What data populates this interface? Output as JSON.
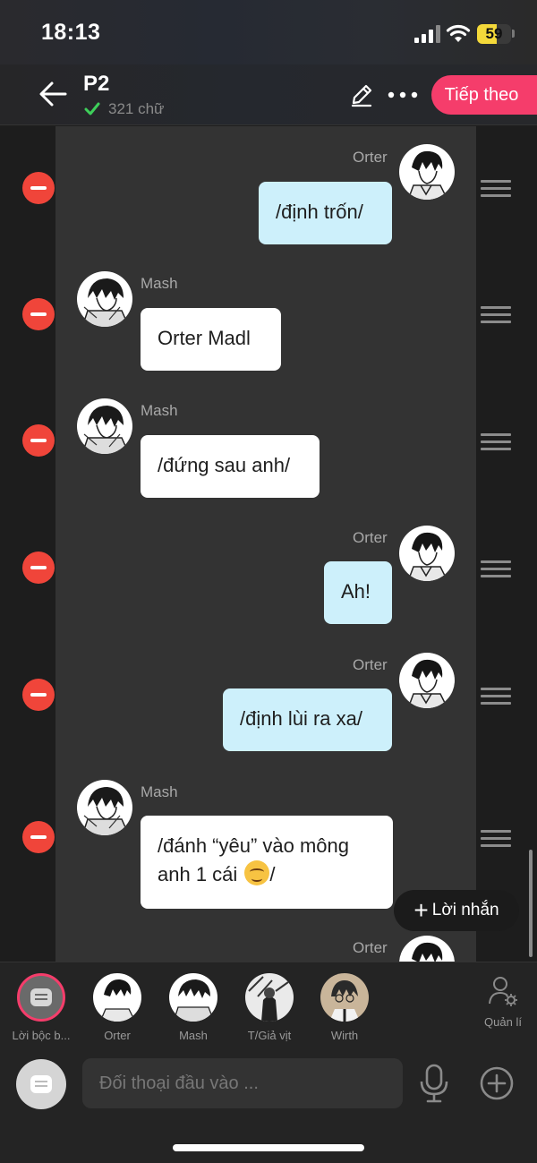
{
  "status_bar": {
    "time": "18:13",
    "battery": "59",
    "battery_level": 0.59
  },
  "header": {
    "title": "P2",
    "word_count": "321 chữ",
    "next_label": "Tiếp theo"
  },
  "messages": [
    {
      "side": "right",
      "name": "Orter",
      "text": "/định trốn/",
      "avatar": "orter-avatar"
    },
    {
      "side": "left",
      "name": "Mash",
      "text": "Orter Madl",
      "avatar": "mash-avatar"
    },
    {
      "side": "left",
      "name": "Mash",
      "text": "/đứng sau anh/",
      "avatar": "mash-avatar"
    },
    {
      "side": "right",
      "name": "Orter",
      "text": "Ah!",
      "avatar": "orter-avatar"
    },
    {
      "side": "right",
      "name": "Orter",
      "text": "/định lùi ra xa/",
      "avatar": "orter-avatar"
    },
    {
      "side": "left",
      "name": "Mash",
      "text_line1": "/đánh “yêu” vào mông",
      "text_line2": "anh 1 cái ",
      "text_end": "/",
      "emoji": "hugging-face-emoji",
      "avatar": "mash-avatar"
    },
    {
      "side": "right",
      "name": "Orter",
      "avatar": "orter-avatar"
    }
  ],
  "add_message_label": "Lời nhắn",
  "characters": [
    {
      "label": "Lời bộc b...",
      "icon": "narration-icon",
      "selected": true
    },
    {
      "label": "Orter",
      "icon": "orter-avatar"
    },
    {
      "label": "Mash",
      "icon": "mash-avatar"
    },
    {
      "label": "T/Giả vịt",
      "icon": "tgiavit-avatar"
    },
    {
      "label": "Wirth",
      "icon": "wirth-avatar"
    }
  ],
  "manage_label": "Quản lí",
  "input": {
    "placeholder": "Đối thoại đầu vào ..."
  },
  "colors": {
    "accent": "#f53d6b",
    "bubble_right": "#cdf0fb",
    "bubble_left": "#ffffff",
    "delete": "#f0453a",
    "panel": "#333333"
  }
}
